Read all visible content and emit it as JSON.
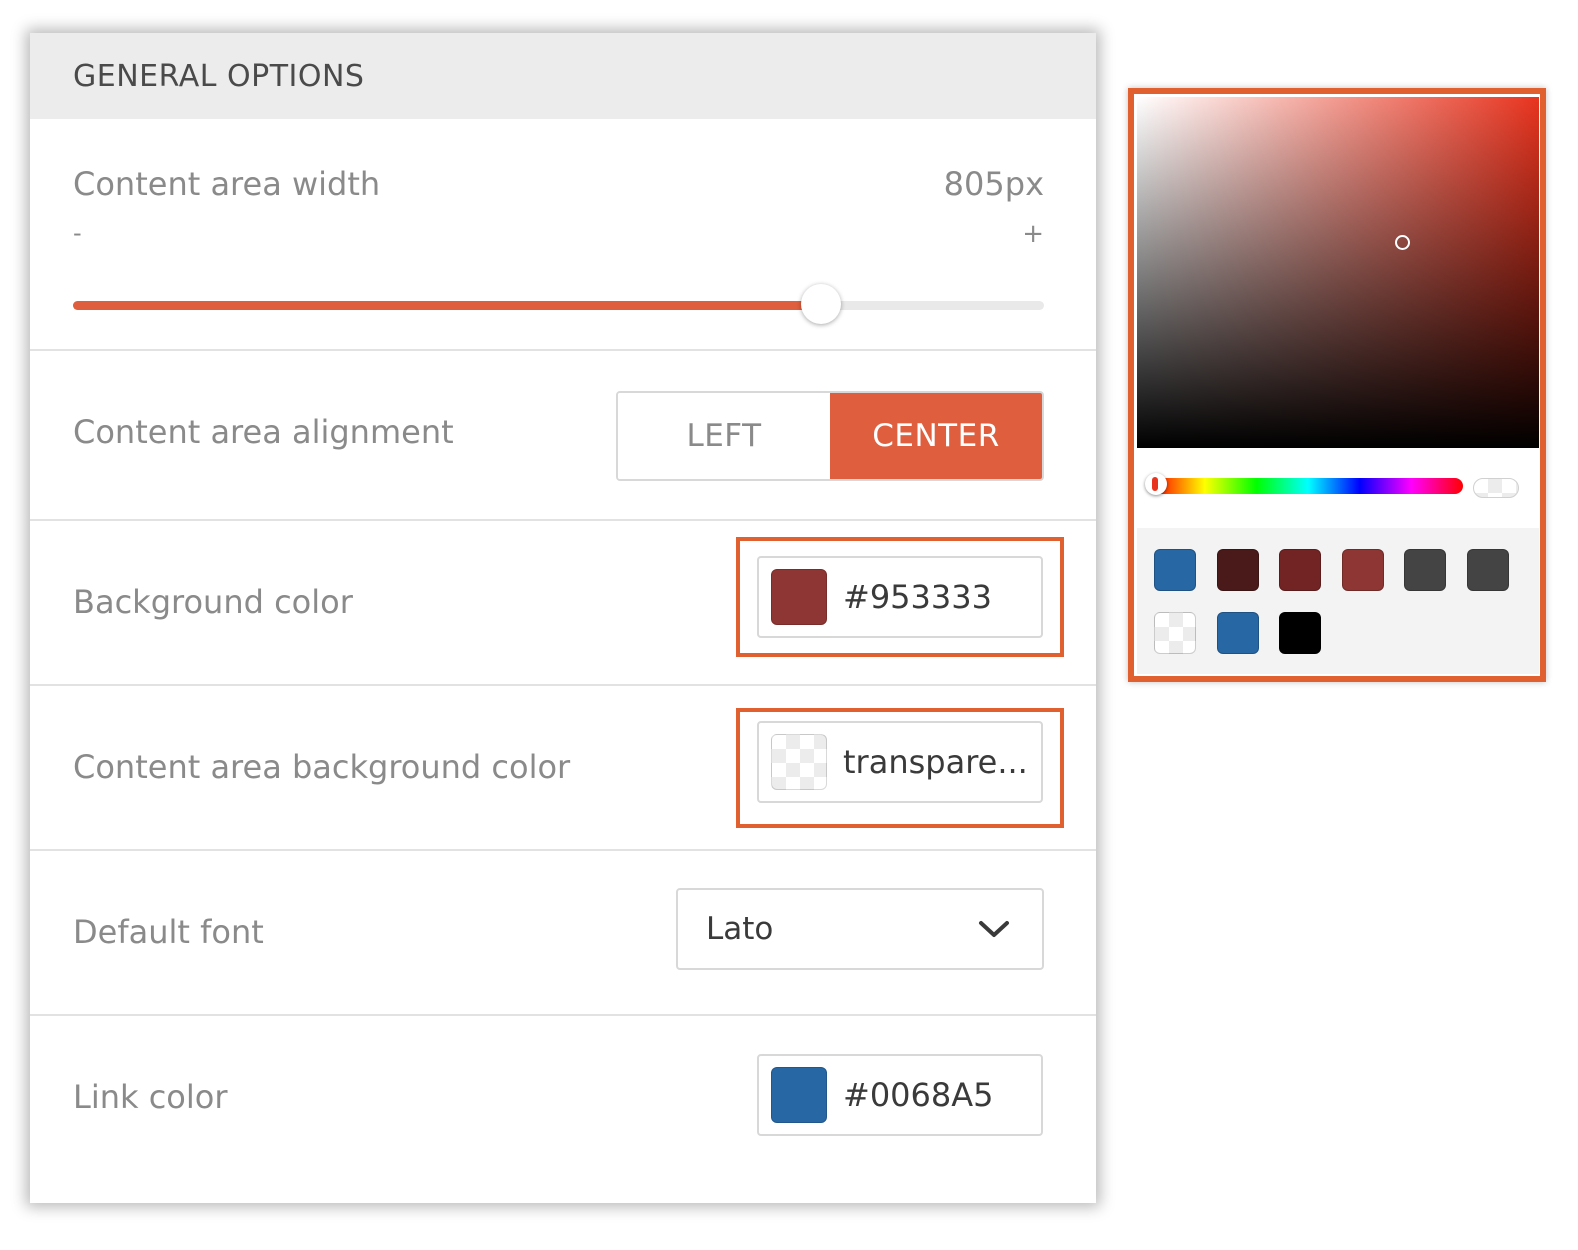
{
  "panel": {
    "title": "GENERAL OPTIONS",
    "width_row": {
      "label": "Content area width",
      "value": "805px",
      "min_symbol": "-",
      "max_symbol": "+",
      "slider_fraction": 0.77
    },
    "alignment_row": {
      "label": "Content area alignment",
      "options": [
        "LEFT",
        "CENTER"
      ],
      "selected": "CENTER"
    },
    "background_row": {
      "label": "Background color",
      "value": "#953333",
      "swatch_color": "#8d3633"
    },
    "content_bg_row": {
      "label": "Content area background color",
      "value": "transpare..."
    },
    "font_row": {
      "label": "Default font",
      "value": "Lato"
    },
    "link_row": {
      "label": "Link color",
      "value": "#0068A5",
      "swatch_color": "#2767a4"
    }
  },
  "colors": {
    "accent": "#df5e3e",
    "highlight_border": "#e0602f"
  },
  "picker": {
    "hue_color": "#e8341f",
    "presets": [
      "#2767a4",
      "#4a1a1a",
      "#722424",
      "#8d3633",
      "#444444",
      "#444444",
      "transparent",
      "#2767a4",
      "#000000"
    ]
  }
}
